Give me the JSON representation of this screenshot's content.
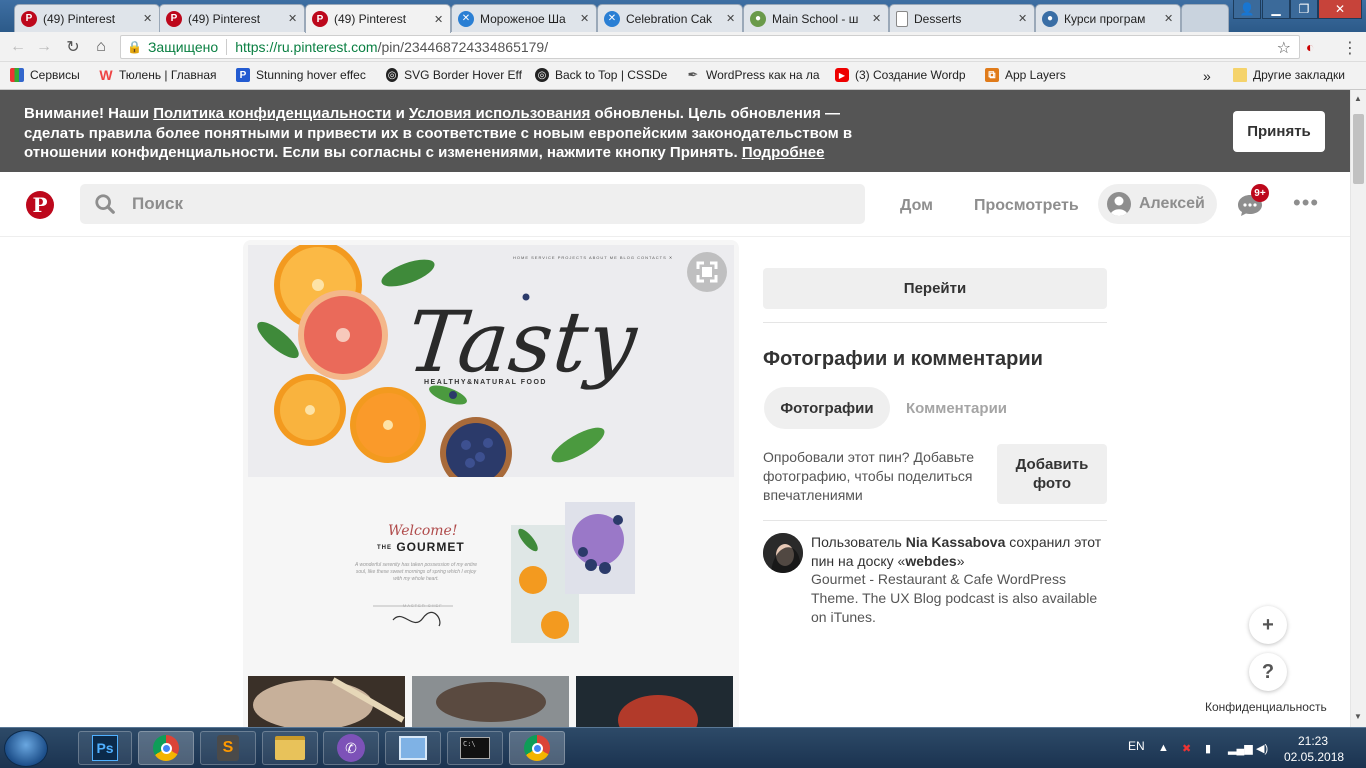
{
  "browser": {
    "tabs": [
      {
        "label": "(49) Pinterest",
        "icon": "pinterest-favicon",
        "active": false
      },
      {
        "label": "(49) Pinterest",
        "icon": "pinterest-favicon",
        "active": false
      },
      {
        "label": "(49) Pinterest",
        "icon": "pinterest-favicon",
        "active": true
      },
      {
        "label": "Мороженое Ша",
        "icon": "x-favicon",
        "active": false
      },
      {
        "label": "Celebration Cak",
        "icon": "x-favicon",
        "active": false
      },
      {
        "label": "Main School - ш",
        "icon": "globe-favicon",
        "active": false
      },
      {
        "label": "Desserts",
        "icon": "document-favicon",
        "active": false
      },
      {
        "label": "Курси програм",
        "icon": "globe-favicon",
        "active": false
      }
    ],
    "secure_label": "Защищено",
    "url_host": "https://ru.pinterest.com",
    "url_path": "/pin/234468724334865179/",
    "bookmarks": [
      {
        "label": "Сервисы",
        "icon": "apps-grid"
      },
      {
        "label": "Тюлень | Главная",
        "icon": "w-logo"
      },
      {
        "label": "Stunning hover effec",
        "icon": "p-logo"
      },
      {
        "label": "SVG Border Hover Eff",
        "icon": "codepen-logo"
      },
      {
        "label": "Back to Top | CSSDe",
        "icon": "codepen-logo"
      },
      {
        "label": "WordPress как на ла",
        "icon": "pen-logo"
      },
      {
        "label": "(3) Создание Wordp",
        "icon": "youtube-logo"
      },
      {
        "label": "App Layers",
        "icon": "app-layers-logo"
      }
    ],
    "bookmarks_more": "»",
    "other_bookmarks": "Другие закладки"
  },
  "banner": {
    "text_1": "Внимание! Наши ",
    "link_privacy": "Политика конфиденциальности",
    "text_2": " и ",
    "link_terms": "Условия использования",
    "text_3": " обновлены. Цель обновления — сделать правила более понятными и привести их в соответствие с новым европейским законодательством в отношении конфиденциальности. Если вы согласны с изменениями, нажмите кнопку Принять. ",
    "link_more": "Подробнее",
    "accept_label": "Принять"
  },
  "header": {
    "search_placeholder": "Поиск",
    "nav_home": "Дом",
    "nav_browse": "Просмотреть",
    "user_name": "Алексей",
    "notifications_badge": "9+"
  },
  "pin": {
    "hero_nav": "HOME   SERVICE   PROJECTS   ABOUT ME   BLOG   CONTACTS   ✕",
    "hero_title": "Tasty",
    "hero_subtitle": "HEALTHY&NATURAL FOOD",
    "welcome": "Welcome!",
    "gourmet_the": "THE",
    "gourmet_name": "GOURMET",
    "gourmet_desc": "A wonderful serenity has taken possession of my entire soul, like these sweet mornings of spring which I enjoy with my whole heart.",
    "gourmet_chef": "MASTER CHEF"
  },
  "sidebar": {
    "goto_label": "Перейти",
    "section_title": "Фотографии и комментарии",
    "tab_photos": "Фотографии",
    "tab_comments": "Комментарии",
    "try_text": "Опробовали этот пин? Добавьте фотографию, чтобы поделиться впечатлениями",
    "add_photo_label": "Добавить фото",
    "saver_prefix": "Пользователь ",
    "saver_name": "Nia Kassabova",
    "saver_mid": " сохранил этот пин на доску «",
    "saver_board": "webdes",
    "saver_suffix": "»",
    "description": "Gourmet - Restaurant & Cafe WordPress Theme. The UX Blog podcast is also available on iTunes."
  },
  "floating": {
    "plus": "+",
    "help": "?",
    "privacy_label": "Конфиденциальность"
  },
  "taskbar": {
    "apps": [
      "photoshop-icon",
      "chrome-icon",
      "sublime-icon",
      "explorer-icon",
      "viber-icon",
      "control-panel-icon",
      "cmd-icon",
      "chrome-icon"
    ],
    "lang": "EN",
    "time": "21:23",
    "date": "02.05.2018"
  },
  "colors": {
    "pinterest_red": "#bd081c",
    "banner_bg": "#555555",
    "secure_green": "#0b8043"
  }
}
